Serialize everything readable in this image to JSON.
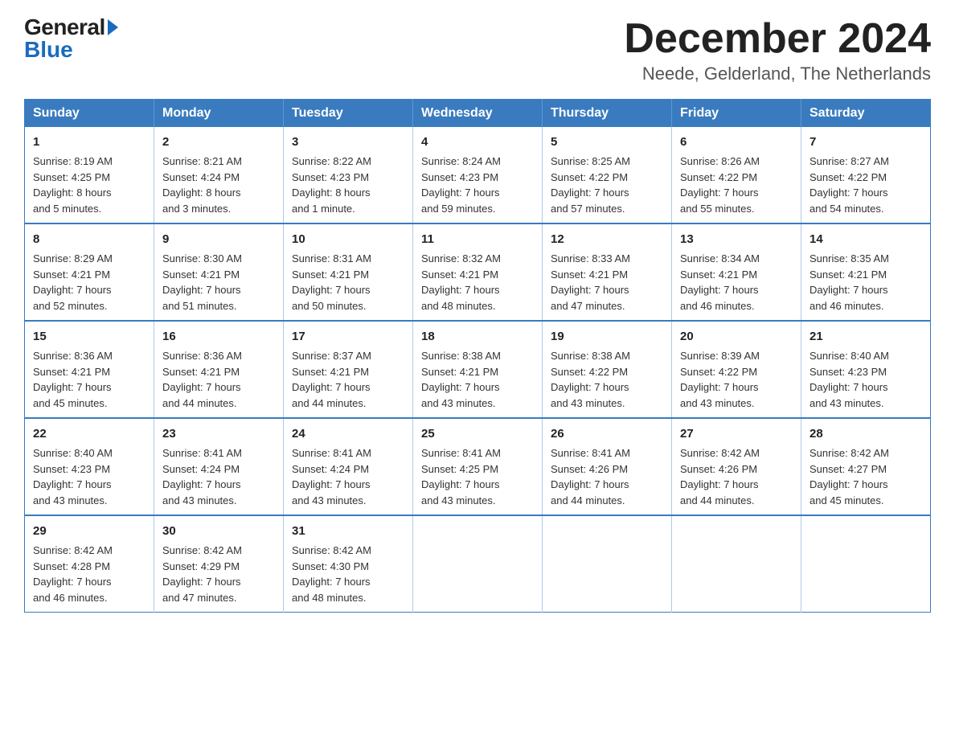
{
  "logo": {
    "general": "General",
    "blue": "Blue"
  },
  "title": "December 2024",
  "location": "Neede, Gelderland, The Netherlands",
  "weekdays": [
    "Sunday",
    "Monday",
    "Tuesday",
    "Wednesday",
    "Thursday",
    "Friday",
    "Saturday"
  ],
  "weeks": [
    [
      {
        "day": "1",
        "sunrise": "8:19 AM",
        "sunset": "4:25 PM",
        "daylight": "8 hours and 5 minutes."
      },
      {
        "day": "2",
        "sunrise": "8:21 AM",
        "sunset": "4:24 PM",
        "daylight": "8 hours and 3 minutes."
      },
      {
        "day": "3",
        "sunrise": "8:22 AM",
        "sunset": "4:23 PM",
        "daylight": "8 hours and 1 minute."
      },
      {
        "day": "4",
        "sunrise": "8:24 AM",
        "sunset": "4:23 PM",
        "daylight": "7 hours and 59 minutes."
      },
      {
        "day": "5",
        "sunrise": "8:25 AM",
        "sunset": "4:22 PM",
        "daylight": "7 hours and 57 minutes."
      },
      {
        "day": "6",
        "sunrise": "8:26 AM",
        "sunset": "4:22 PM",
        "daylight": "7 hours and 55 minutes."
      },
      {
        "day": "7",
        "sunrise": "8:27 AM",
        "sunset": "4:22 PM",
        "daylight": "7 hours and 54 minutes."
      }
    ],
    [
      {
        "day": "8",
        "sunrise": "8:29 AM",
        "sunset": "4:21 PM",
        "daylight": "7 hours and 52 minutes."
      },
      {
        "day": "9",
        "sunrise": "8:30 AM",
        "sunset": "4:21 PM",
        "daylight": "7 hours and 51 minutes."
      },
      {
        "day": "10",
        "sunrise": "8:31 AM",
        "sunset": "4:21 PM",
        "daylight": "7 hours and 50 minutes."
      },
      {
        "day": "11",
        "sunrise": "8:32 AM",
        "sunset": "4:21 PM",
        "daylight": "7 hours and 48 minutes."
      },
      {
        "day": "12",
        "sunrise": "8:33 AM",
        "sunset": "4:21 PM",
        "daylight": "7 hours and 47 minutes."
      },
      {
        "day": "13",
        "sunrise": "8:34 AM",
        "sunset": "4:21 PM",
        "daylight": "7 hours and 46 minutes."
      },
      {
        "day": "14",
        "sunrise": "8:35 AM",
        "sunset": "4:21 PM",
        "daylight": "7 hours and 46 minutes."
      }
    ],
    [
      {
        "day": "15",
        "sunrise": "8:36 AM",
        "sunset": "4:21 PM",
        "daylight": "7 hours and 45 minutes."
      },
      {
        "day": "16",
        "sunrise": "8:36 AM",
        "sunset": "4:21 PM",
        "daylight": "7 hours and 44 minutes."
      },
      {
        "day": "17",
        "sunrise": "8:37 AM",
        "sunset": "4:21 PM",
        "daylight": "7 hours and 44 minutes."
      },
      {
        "day": "18",
        "sunrise": "8:38 AM",
        "sunset": "4:21 PM",
        "daylight": "7 hours and 43 minutes."
      },
      {
        "day": "19",
        "sunrise": "8:38 AM",
        "sunset": "4:22 PM",
        "daylight": "7 hours and 43 minutes."
      },
      {
        "day": "20",
        "sunrise": "8:39 AM",
        "sunset": "4:22 PM",
        "daylight": "7 hours and 43 minutes."
      },
      {
        "day": "21",
        "sunrise": "8:40 AM",
        "sunset": "4:23 PM",
        "daylight": "7 hours and 43 minutes."
      }
    ],
    [
      {
        "day": "22",
        "sunrise": "8:40 AM",
        "sunset": "4:23 PM",
        "daylight": "7 hours and 43 minutes."
      },
      {
        "day": "23",
        "sunrise": "8:41 AM",
        "sunset": "4:24 PM",
        "daylight": "7 hours and 43 minutes."
      },
      {
        "day": "24",
        "sunrise": "8:41 AM",
        "sunset": "4:24 PM",
        "daylight": "7 hours and 43 minutes."
      },
      {
        "day": "25",
        "sunrise": "8:41 AM",
        "sunset": "4:25 PM",
        "daylight": "7 hours and 43 minutes."
      },
      {
        "day": "26",
        "sunrise": "8:41 AM",
        "sunset": "4:26 PM",
        "daylight": "7 hours and 44 minutes."
      },
      {
        "day": "27",
        "sunrise": "8:42 AM",
        "sunset": "4:26 PM",
        "daylight": "7 hours and 44 minutes."
      },
      {
        "day": "28",
        "sunrise": "8:42 AM",
        "sunset": "4:27 PM",
        "daylight": "7 hours and 45 minutes."
      }
    ],
    [
      {
        "day": "29",
        "sunrise": "8:42 AM",
        "sunset": "4:28 PM",
        "daylight": "7 hours and 46 minutes."
      },
      {
        "day": "30",
        "sunrise": "8:42 AM",
        "sunset": "4:29 PM",
        "daylight": "7 hours and 47 minutes."
      },
      {
        "day": "31",
        "sunrise": "8:42 AM",
        "sunset": "4:30 PM",
        "daylight": "7 hours and 48 minutes."
      },
      null,
      null,
      null,
      null
    ]
  ],
  "labels": {
    "sunrise": "Sunrise:",
    "sunset": "Sunset:",
    "daylight": "Daylight:"
  }
}
